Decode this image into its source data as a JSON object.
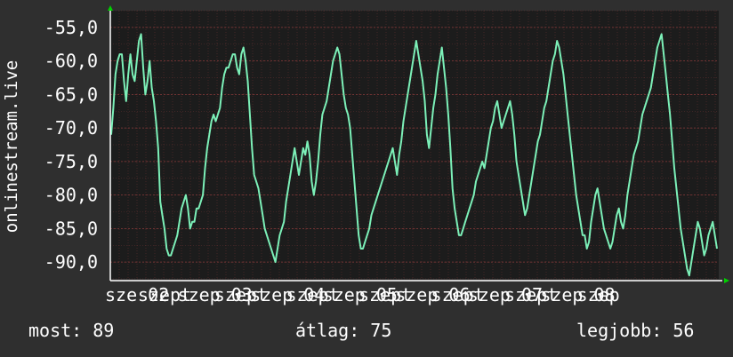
{
  "colors": {
    "background": "#2f2f2f",
    "plot_background": "#1c1c1c",
    "line": "#7cf0b8",
    "grid": "#8a3a3a",
    "axis": "#ffffff",
    "arrow": "#00d000"
  },
  "chart_data": {
    "type": "line",
    "title": "",
    "xlabel": "",
    "ylabel": "onlinestream.live",
    "ylim": [
      -92.5,
      -52.5
    ],
    "yticks": [
      "-55,0",
      "-60,0",
      "-65,0",
      "-70,0",
      "-75,0",
      "-80,0",
      "-85,0",
      "-90,0"
    ],
    "ytick_values": [
      -55,
      -60,
      -65,
      -70,
      -75,
      -80,
      -85,
      -90
    ],
    "xlim": [
      0,
      7.8
    ],
    "xtick_labels": [
      "sze 02",
      "szept",
      "szep 03",
      "szept",
      "szep 04",
      "szept",
      "szep 05",
      "szept",
      "szep 06",
      "szept",
      "szep 07",
      "szept",
      "szep 08",
      "szep"
    ],
    "xtick_values": [
      0,
      0.42,
      0.93,
      1.4,
      1.86,
      2.32,
      2.79,
      3.25,
      3.72,
      4.18,
      4.65,
      5.12,
      5.58,
      6.05
    ],
    "grid": true,
    "series": [
      {
        "values": [
          -71,
          -67,
          -62,
          -60,
          -59,
          -59,
          -63,
          -66,
          -62,
          -59,
          -62,
          -63,
          -60,
          -57,
          -56,
          -61,
          -65,
          -63,
          -60,
          -64,
          -66,
          -69,
          -73,
          -81,
          -83,
          -85,
          -88,
          -89,
          -89,
          -88,
          -87,
          -86,
          -84,
          -82,
          -81,
          -80,
          -82,
          -85,
          -84,
          -84,
          -82,
          -82,
          -81,
          -80,
          -76,
          -73,
          -71,
          -69,
          -68,
          -69,
          -68,
          -67,
          -64,
          -62,
          -61,
          -61,
          -60,
          -59,
          -59,
          -61,
          -62,
          -59,
          -58,
          -60,
          -63,
          -68,
          -73,
          -77,
          -78,
          -79,
          -81,
          -83,
          -85,
          -86,
          -87,
          -88,
          -89,
          -90,
          -88,
          -86,
          -85,
          -84,
          -81,
          -79,
          -77,
          -75,
          -73,
          -75,
          -77,
          -75,
          -73,
          -74,
          -72,
          -74,
          -78,
          -80,
          -78,
          -75,
          -71,
          -68,
          -67,
          -66,
          -64,
          -62,
          -60,
          -59,
          -58,
          -59,
          -62,
          -65,
          -67,
          -68,
          -70,
          -74,
          -78,
          -82,
          -86,
          -88,
          -88,
          -87,
          -86,
          -85,
          -83,
          -82,
          -81,
          -80,
          -79,
          -78,
          -77,
          -76,
          -75,
          -74,
          -73,
          -75,
          -77,
          -74,
          -72,
          -69,
          -67,
          -65,
          -63,
          -61,
          -59,
          -57,
          -59,
          -61,
          -63,
          -66,
          -71,
          -73,
          -70,
          -67,
          -65,
          -62,
          -60,
          -58,
          -61,
          -64,
          -68,
          -73,
          -79,
          -82,
          -84,
          -86,
          -86,
          -85,
          -84,
          -83,
          -82,
          -81,
          -80,
          -78,
          -77,
          -76,
          -75,
          -76,
          -74,
          -72,
          -70,
          -69,
          -67,
          -66,
          -68,
          -70,
          -69,
          -68,
          -67,
          -66,
          -68,
          -71,
          -75,
          -77,
          -79,
          -81,
          -83,
          -82,
          -80,
          -78,
          -76,
          -74,
          -72,
          -71,
          -69,
          -67,
          -66,
          -64,
          -62,
          -60,
          -59,
          -57,
          -58,
          -60,
          -62,
          -65,
          -68,
          -71,
          -74,
          -77,
          -80,
          -82,
          -84,
          -86,
          -86,
          -88,
          -87,
          -84,
          -82,
          -80,
          -79,
          -81,
          -83,
          -85,
          -86,
          -87,
          -88,
          -87,
          -85,
          -83,
          -82,
          -84,
          -85,
          -83,
          -80,
          -78,
          -76,
          -74,
          -73,
          -72,
          -70,
          -68,
          -67,
          -66,
          -65,
          -64,
          -62,
          -60,
          -58,
          -57,
          -56,
          -59,
          -62,
          -65,
          -68,
          -72,
          -76,
          -79,
          -82,
          -85,
          -87,
          -89,
          -91,
          -92,
          -90,
          -88,
          -86,
          -84,
          -85,
          -87,
          -89,
          -88,
          -86,
          -85,
          -84,
          -86,
          -88
        ]
      }
    ]
  },
  "footer": {
    "now_label": "most:",
    "now_value": "89",
    "avg_label": "átlag:",
    "avg_value": "75",
    "best_label": "legjobb:",
    "best_value": "56"
  }
}
